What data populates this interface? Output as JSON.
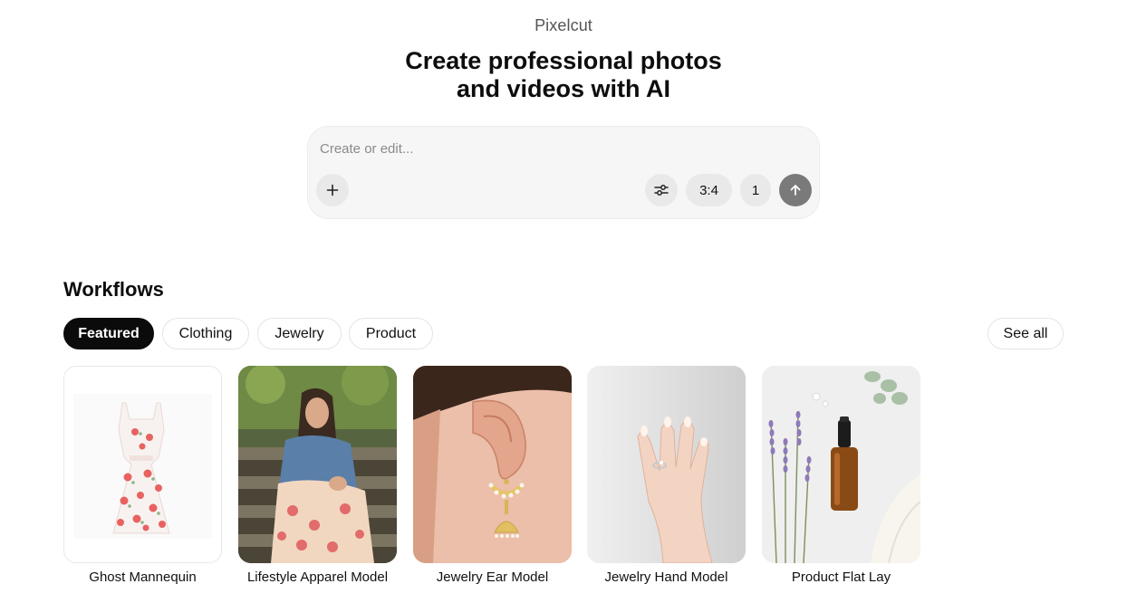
{
  "app": {
    "brand": "Pixelcut"
  },
  "hero": {
    "line1": "Create professional photos",
    "line2": "and videos with AI"
  },
  "prompt": {
    "placeholder": "Create or edit...",
    "add_icon": "plus-icon",
    "settings_icon": "sliders-icon",
    "aspect_ratio": "3:4",
    "count": "1",
    "submit_icon": "arrow-up-icon"
  },
  "workflows": {
    "title": "Workflows",
    "filters": [
      {
        "label": "Featured",
        "active": true
      },
      {
        "label": "Clothing",
        "active": false
      },
      {
        "label": "Jewelry",
        "active": false
      },
      {
        "label": "Product",
        "active": false
      }
    ],
    "see_all": "See all",
    "cards": [
      {
        "label": "Ghost Mannequin"
      },
      {
        "label": "Lifestyle Apparel Model"
      },
      {
        "label": "Jewelry Ear Model"
      },
      {
        "label": "Jewelry Hand Model"
      },
      {
        "label": "Product Flat Lay"
      }
    ]
  },
  "colors": {
    "accent_chip": "#0b0b0b",
    "submit_button": "#7a7a7a",
    "prompt_bg": "#f6f6f6"
  }
}
